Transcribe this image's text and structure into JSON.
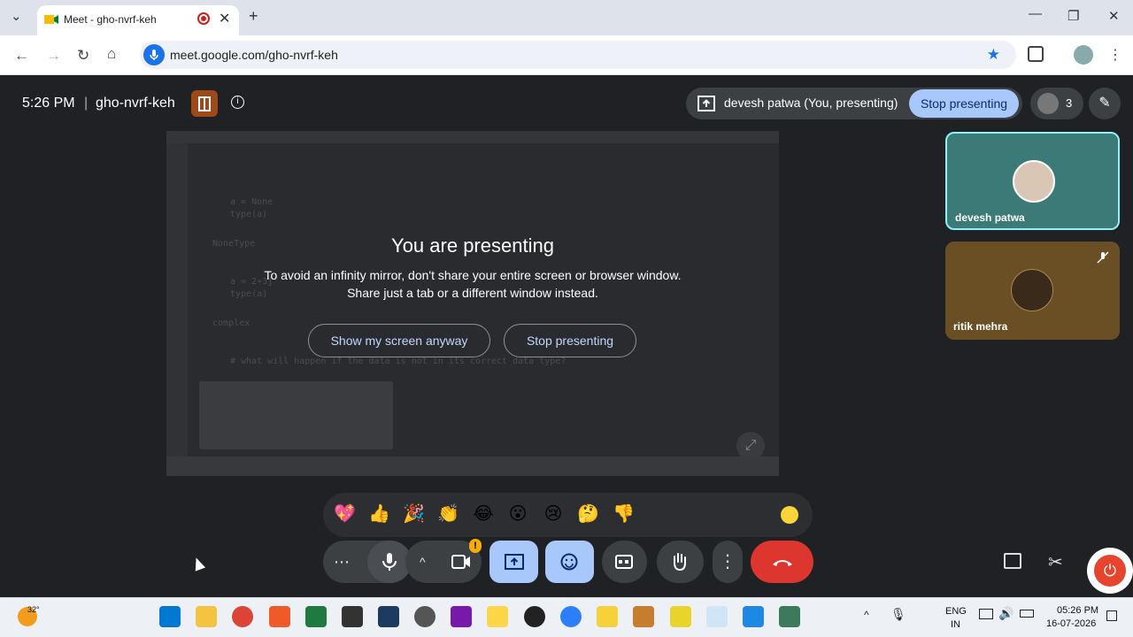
{
  "browser": {
    "tab_title": "Meet - gho-nvrf-keh",
    "tab_close": "✕",
    "new_tab": "+",
    "url": "meet.google.com/gho-nvrf-keh",
    "window_controls": [
      "—",
      "❐",
      "✕"
    ]
  },
  "meet": {
    "time": "5:26 PM",
    "separator": "|",
    "meeting_code": "gho-nvrf-keh",
    "presenting_label": "devesh patwa (You, presenting)",
    "stop_presenting_top": "Stop presenting",
    "participant_count": "3",
    "overlay": {
      "title": "You are presenting",
      "line1": "To avoid an infinity mirror, don't share your entire screen or browser window.",
      "line2": "Share just a tab or a different window instead.",
      "show_anyway": "Show my screen anyway",
      "stop_presenting": "Stop presenting"
    },
    "shared_screen_code": [
      "a = None",
      "type(a)",
      "NoneType",
      "a = 2+3j",
      "type(a)",
      "complex",
      "# what will happen if the data is not in its correct data type?"
    ],
    "participants": [
      {
        "name": "devesh patwa",
        "active": true
      },
      {
        "name": "ritik mehra",
        "muted": true
      }
    ],
    "reactions": [
      "💖",
      "👍",
      "🎉",
      "👏",
      "😂",
      "😮",
      "😢",
      "🤔",
      "👎"
    ],
    "controls": {
      "more_options": "⋯",
      "chevron": "^",
      "camera_warning": "!",
      "more_vert": "⋮"
    }
  },
  "taskbar": {
    "weather_temp": "32°",
    "language_line1": "ENG",
    "language_line2": "IN",
    "time": "05:26 PM",
    "date": "16-07-2026"
  },
  "colors": {
    "meet_bg": "#202124",
    "accent_blue": "#a8c7fa",
    "end_call_red": "#dc362e",
    "tile_active_border": "#8ff0f5"
  }
}
